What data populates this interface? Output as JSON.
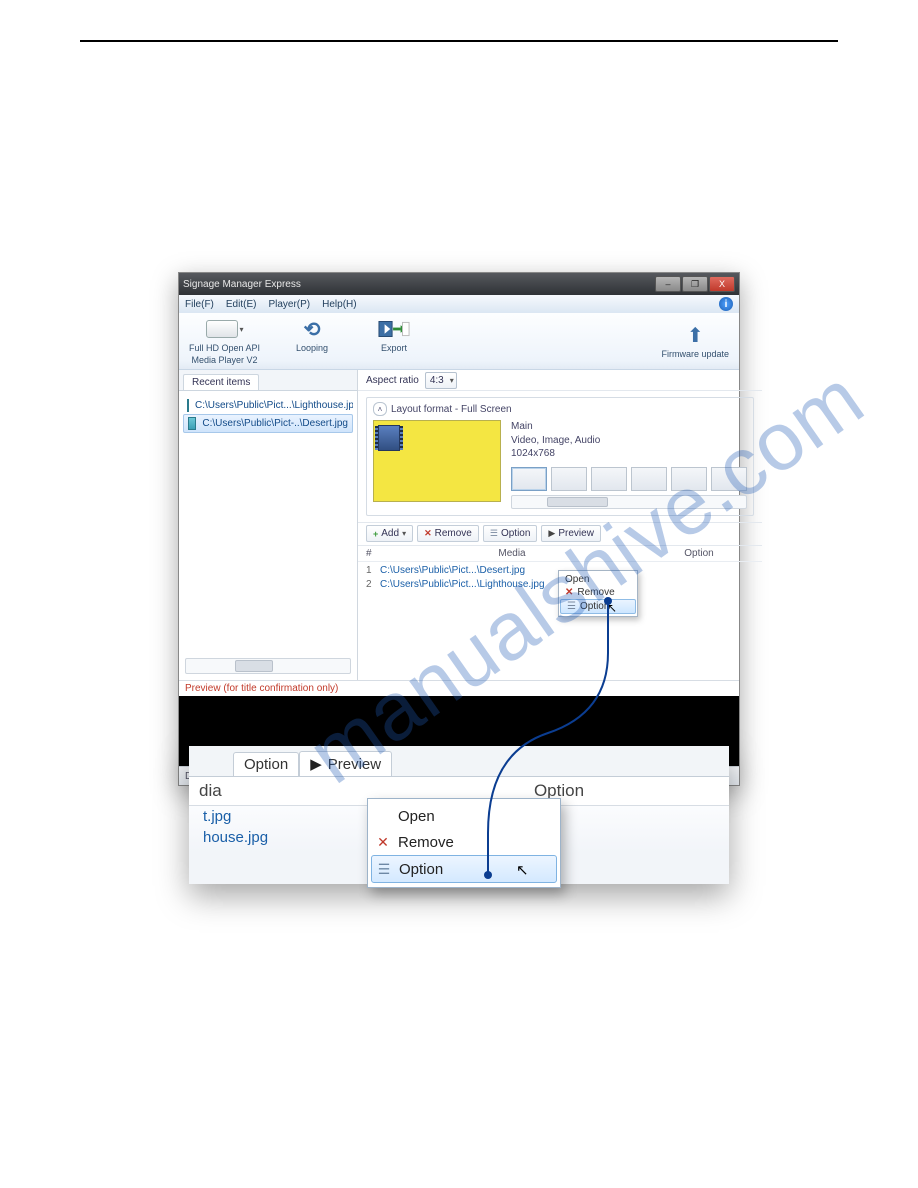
{
  "watermark": "manualshive.com",
  "window": {
    "title": "Signage Manager Express",
    "minimize": "–",
    "maximize": "❐",
    "close": "X"
  },
  "menu": {
    "file": "File(F)",
    "edit": "Edit(E)",
    "player": "Player(P)",
    "help": "Help(H)"
  },
  "toolbar": {
    "device_l1": "Full HD Open API",
    "device_l2": "Media Player V2",
    "looping": "Looping",
    "export": "Export",
    "firmware": "Firmware update"
  },
  "left": {
    "tab_recent": "Recent items",
    "items": [
      "C:\\Users\\Public\\Pict...\\Lighthouse.jpg",
      "C:\\Users\\Public\\Pict-..\\Desert.jpg"
    ]
  },
  "right": {
    "aspect_label": "Aspect ratio",
    "aspect_value": "4:3",
    "layout_header": "Layout format - Full Screen",
    "layout_meta_title": "Main",
    "layout_meta_sub": "Video, Image, Audio",
    "layout_meta_res": "1024x768"
  },
  "actions": {
    "add": "Add",
    "remove": "Remove",
    "option": "Option",
    "preview": "Preview"
  },
  "grid": {
    "col_num": "#",
    "col_media": "Media",
    "col_option": "Option",
    "rows": [
      {
        "n": "1",
        "path": "C:\\Users\\Public\\Pict...\\Desert.jpg"
      },
      {
        "n": "2",
        "path": "C:\\Users\\Public\\Pict...\\Lighthouse.jpg"
      }
    ]
  },
  "ctx_small": {
    "open": "Open",
    "remove": "Remove",
    "option": "Option"
  },
  "preview_label": "Preview (for title confirmation only)",
  "dragbar": "Drag",
  "zoom": {
    "tab_option": "Option",
    "tab_preview": "Preview",
    "col_media_tail": "dia",
    "col_option": "Option",
    "row1": "t.jpg",
    "row2": "house.jpg"
  },
  "ctx_big": {
    "open": "Open",
    "remove": "Remove",
    "option": "Option"
  }
}
